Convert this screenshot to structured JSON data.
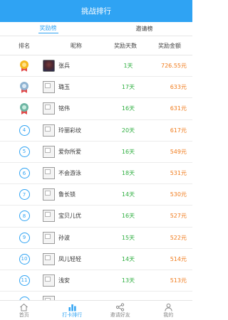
{
  "header": {
    "title": "挑战排行"
  },
  "tabs": [
    {
      "label": "奖励榜",
      "active": true
    },
    {
      "label": "邀请榜",
      "active": false
    }
  ],
  "columns": {
    "rank": "排名",
    "nick": "昵称",
    "days": "奖励天数",
    "amount": "奖励金额"
  },
  "rows": [
    {
      "rank": "1",
      "medal": "gold",
      "avatar": "photo",
      "name": "张兵",
      "days": "1天",
      "amount": "726.55元"
    },
    {
      "rank": "2",
      "medal": "silver",
      "avatar": "broken",
      "name": "璐玉",
      "days": "17天",
      "amount": "633元"
    },
    {
      "rank": "3",
      "medal": "bronze",
      "avatar": "broken",
      "name": "铭伟",
      "days": "16天",
      "amount": "631元"
    },
    {
      "rank": "4",
      "medal": "",
      "avatar": "broken",
      "name": "玲丽彩纹",
      "days": "20天",
      "amount": "617元"
    },
    {
      "rank": "5",
      "medal": "",
      "avatar": "broken",
      "name": "爱你所爱",
      "days": "16天",
      "amount": "549元"
    },
    {
      "rank": "6",
      "medal": "",
      "avatar": "broken",
      "name": "不会游泳",
      "days": "18天",
      "amount": "531元"
    },
    {
      "rank": "7",
      "medal": "",
      "avatar": "broken",
      "name": "鲁长锁",
      "days": "14天",
      "amount": "530元"
    },
    {
      "rank": "8",
      "medal": "",
      "avatar": "broken",
      "name": "宝贝儿优",
      "days": "16天",
      "amount": "527元"
    },
    {
      "rank": "9",
      "medal": "",
      "avatar": "broken",
      "name": "孙波",
      "days": "15天",
      "amount": "522元"
    },
    {
      "rank": "10",
      "medal": "",
      "avatar": "broken",
      "name": "凤儿轻轻",
      "days": "14天",
      "amount": "514元"
    },
    {
      "rank": "11",
      "medal": "",
      "avatar": "broken",
      "name": "浅安",
      "days": "13天",
      "amount": "513元"
    },
    {
      "rank": "12",
      "medal": "",
      "avatar": "broken",
      "name": "",
      "days": "",
      "amount": ""
    }
  ],
  "bottom_nav": [
    {
      "label": "首页",
      "icon": "home-icon",
      "active": false
    },
    {
      "label": "打卡排行",
      "icon": "chart-icon",
      "active": true
    },
    {
      "label": "邀请好友",
      "icon": "share-icon",
      "active": false
    },
    {
      "label": "我的",
      "icon": "user-icon",
      "active": false
    }
  ],
  "colors": {
    "primary": "#2fa3f3",
    "days_green": "#2dae3f",
    "amount_orange": "#f07b1c"
  }
}
